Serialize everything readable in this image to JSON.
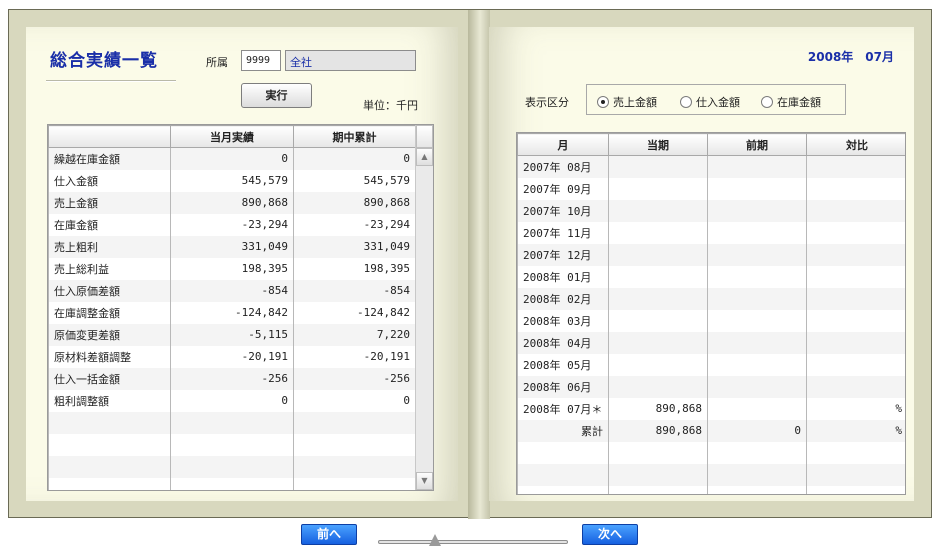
{
  "left": {
    "title": "総合実績一覧",
    "dept_label": "所属",
    "dept_code": "9999",
    "dept_name": "全社",
    "run_label": "実行",
    "unit": "単位：千円",
    "columns": [
      "",
      "当月実績",
      "期中累計"
    ],
    "rows": [
      {
        "label": "繰越在庫金額",
        "month": "0",
        "cumulative": "0"
      },
      {
        "label": "仕入金額",
        "month": "545,579",
        "cumulative": "545,579"
      },
      {
        "label": "売上金額",
        "month": "890,868",
        "cumulative": "890,868"
      },
      {
        "label": "在庫金額",
        "month": "-23,294",
        "cumulative": "-23,294"
      },
      {
        "label": "売上粗利",
        "month": "331,049",
        "cumulative": "331,049"
      },
      {
        "label": "売上総利益",
        "month": "198,395",
        "cumulative": "198,395"
      },
      {
        "label": "仕入原価差額",
        "month": "-854",
        "cumulative": "-854"
      },
      {
        "label": "在庫調整金額",
        "month": "-124,842",
        "cumulative": "-124,842"
      },
      {
        "label": "原価変更差額",
        "month": "-5,115",
        "cumulative": "7,220"
      },
      {
        "label": "原材料差額調整",
        "month": "-20,191",
        "cumulative": "-20,191"
      },
      {
        "label": "仕入一括金額",
        "month": "-256",
        "cumulative": "-256"
      },
      {
        "label": "粗利調整額",
        "month": "0",
        "cumulative": "0"
      },
      {
        "label": "",
        "month": "",
        "cumulative": ""
      },
      {
        "label": "",
        "month": "",
        "cumulative": ""
      },
      {
        "label": "",
        "month": "",
        "cumulative": ""
      },
      {
        "label": "",
        "month": "",
        "cumulative": ""
      }
    ]
  },
  "right": {
    "date": "2008年　07月",
    "disp_label": "表示区分",
    "radios": [
      {
        "label": "売上金額",
        "selected": true
      },
      {
        "label": "仕入金額",
        "selected": false
      },
      {
        "label": "在庫金額",
        "selected": false
      }
    ],
    "columns": [
      "月",
      "当期",
      "前期",
      "対比"
    ],
    "rows": [
      {
        "month": "2007年 08月",
        "current": "",
        "previous": "",
        "ratio": ""
      },
      {
        "month": "2007年 09月",
        "current": "",
        "previous": "",
        "ratio": ""
      },
      {
        "month": "2007年 10月",
        "current": "",
        "previous": "",
        "ratio": ""
      },
      {
        "month": "2007年 11月",
        "current": "",
        "previous": "",
        "ratio": ""
      },
      {
        "month": "2007年 12月",
        "current": "",
        "previous": "",
        "ratio": ""
      },
      {
        "month": "2008年 01月",
        "current": "",
        "previous": "",
        "ratio": ""
      },
      {
        "month": "2008年 02月",
        "current": "",
        "previous": "",
        "ratio": ""
      },
      {
        "month": "2008年 03月",
        "current": "",
        "previous": "",
        "ratio": ""
      },
      {
        "month": "2008年 04月",
        "current": "",
        "previous": "",
        "ratio": ""
      },
      {
        "month": "2008年 05月",
        "current": "",
        "previous": "",
        "ratio": ""
      },
      {
        "month": "2008年 06月",
        "current": "",
        "previous": "",
        "ratio": ""
      },
      {
        "month": "2008年 07月＊",
        "current": "890,868",
        "previous": "",
        "ratio": "%"
      },
      {
        "month": "累計",
        "current": "890,868",
        "previous": "0",
        "ratio": "%",
        "total": true
      },
      {
        "month": "",
        "current": "",
        "previous": "",
        "ratio": ""
      },
      {
        "month": "",
        "current": "",
        "previous": "",
        "ratio": ""
      },
      {
        "month": "",
        "current": "",
        "previous": "",
        "ratio": ""
      }
    ]
  },
  "nav": {
    "prev_label": "前へ",
    "next_label": "次へ",
    "slider_position": 0.3
  }
}
